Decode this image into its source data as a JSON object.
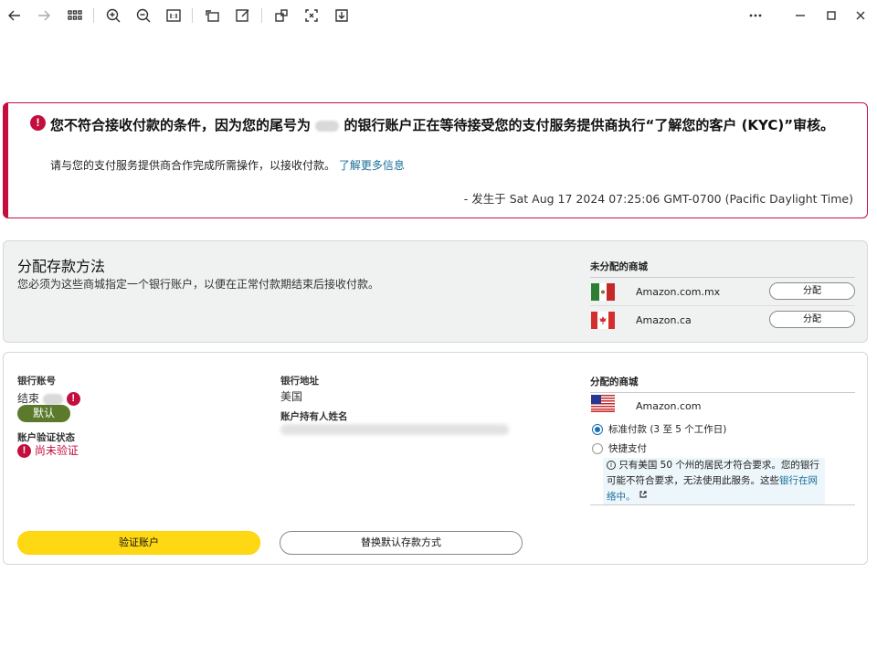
{
  "toolbar": {
    "buttons": [
      "back-icon",
      "forward-icon",
      "grid-icon",
      "zoom-in-icon",
      "zoom-out-icon",
      "actual-size-icon",
      "rotate-icon",
      "edit-icon",
      "crop-icon",
      "fit-screen-icon",
      "save-icon"
    ],
    "window_controls": [
      "more-icon",
      "minimize-icon",
      "maximize-icon",
      "close-icon"
    ]
  },
  "alert": {
    "title_part1": "您不符合接收付款的条件，因为您的尾号为",
    "title_part2": "的银行账户正在等待接受您的支付服务提供商执行“了解您的客户 (KYC)”审核。",
    "message": "请与您的支付服务提供商合作完成所需操作，以接收付款。",
    "learn_more": "了解更多信息",
    "timestamp": "- 发生于 Sat Aug 17 2024 07:25:06 GMT-0700 (Pacific Daylight Time)"
  },
  "assign": {
    "title": "分配存款方法",
    "description": "您必须为这些商城指定一个银行账户，以便在正常付款期结束后接收付款。",
    "unassigned_heading": "未分配的商城",
    "marketplaces": [
      {
        "name": "Amazon.com.mx",
        "button": "分配",
        "flag": "mexico"
      },
      {
        "name": "Amazon.ca",
        "button": "分配",
        "flag": "canada"
      }
    ]
  },
  "account": {
    "bank_account_label": "银行账号",
    "bank_account_value": "结束",
    "default_badge": "默认",
    "verification_label": "账户验证状态",
    "verification_value": "尚未验证",
    "bank_address_label": "银行地址",
    "bank_address_value": "美国",
    "holder_label": "账户持有人姓名",
    "assigned_heading": "分配的商城",
    "assigned_marketplace": "Amazon.com",
    "option_standard": "标准付款 (3 至 5 个工作日)",
    "option_fast": "快捷支付",
    "info_text": "只有美国 50 个州的居民才符合要求。您的银行可能不符合要求，无法使用此服务。这些",
    "info_link": "银行在网络中。",
    "verify_button": "验证账户",
    "replace_button": "替换默认存款方式"
  },
  "colors": {
    "error": "#c40f3e",
    "accent_yellow": "#ffd814",
    "badge_green": "#5c7a2b",
    "link": "#1a6f9a"
  }
}
